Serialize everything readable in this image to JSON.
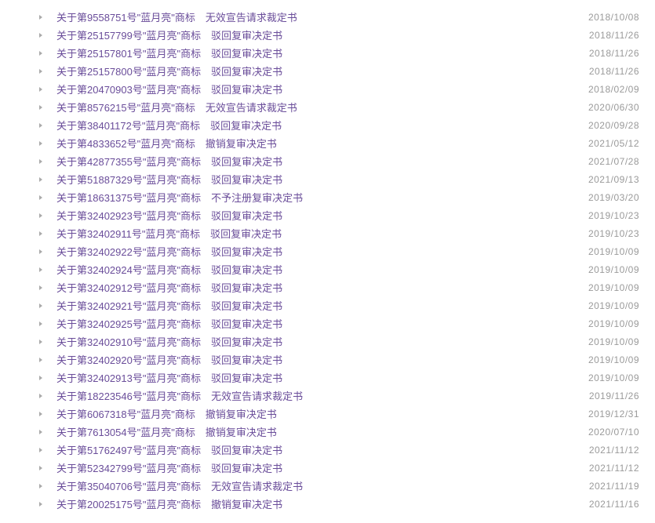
{
  "rows": [
    {
      "title": "关于第9558751号\"蓝月亮\"商标　无效宣告请求裁定书",
      "date": "2018/10/08"
    },
    {
      "title": "关于第25157799号\"蓝月亮\"商标　驳回复审决定书",
      "date": "2018/11/26"
    },
    {
      "title": "关于第25157801号\"蓝月亮\"商标　驳回复审决定书",
      "date": "2018/11/26"
    },
    {
      "title": "关于第25157800号\"蓝月亮\"商标　驳回复审决定书",
      "date": "2018/11/26"
    },
    {
      "title": "关于第20470903号\"蓝月亮\"商标　驳回复审决定书",
      "date": "2018/02/09"
    },
    {
      "title": "关于第8576215号\"蓝月亮\"商标　无效宣告请求裁定书",
      "date": "2020/06/30"
    },
    {
      "title": "关于第38401172号\"蓝月亮\"商标　驳回复审决定书",
      "date": "2020/09/28"
    },
    {
      "title": "关于第4833652号\"蓝月亮\"商标　撤销复审决定书",
      "date": "2021/05/12"
    },
    {
      "title": "关于第42877355号\"蓝月亮\"商标　驳回复审决定书",
      "date": "2021/07/28"
    },
    {
      "title": "关于第51887329号\"蓝月亮\"商标　驳回复审决定书",
      "date": "2021/09/13"
    },
    {
      "title": "关于第18631375号\"蓝月亮\"商标　不予注册复审决定书",
      "date": "2019/03/20"
    },
    {
      "title": "关于第32402923号\"蓝月亮\"商标　驳回复审决定书",
      "date": "2019/10/23"
    },
    {
      "title": "关于第32402911号\"蓝月亮\"商标　驳回复审决定书",
      "date": "2019/10/23"
    },
    {
      "title": "关于第32402922号\"蓝月亮\"商标　驳回复审决定书",
      "date": "2019/10/09"
    },
    {
      "title": "关于第32402924号\"蓝月亮\"商标　驳回复审决定书",
      "date": "2019/10/09"
    },
    {
      "title": "关于第32402912号\"蓝月亮\"商标　驳回复审决定书",
      "date": "2019/10/09"
    },
    {
      "title": "关于第32402921号\"蓝月亮\"商标　驳回复审决定书",
      "date": "2019/10/09"
    },
    {
      "title": "关于第32402925号\"蓝月亮\"商标　驳回复审决定书",
      "date": "2019/10/09"
    },
    {
      "title": "关于第32402910号\"蓝月亮\"商标　驳回复审决定书",
      "date": "2019/10/09"
    },
    {
      "title": "关于第32402920号\"蓝月亮\"商标　驳回复审决定书",
      "date": "2019/10/09"
    },
    {
      "title": "关于第32402913号\"蓝月亮\"商标　驳回复审决定书",
      "date": "2019/10/09"
    },
    {
      "title": "关于第18223546号\"蓝月亮\"商标　无效宣告请求裁定书",
      "date": "2019/11/26"
    },
    {
      "title": "关于第6067318号\"蓝月亮\"商标　撤销复审决定书",
      "date": "2019/12/31"
    },
    {
      "title": "关于第7613054号\"蓝月亮\"商标　撤销复审决定书",
      "date": "2020/07/10"
    },
    {
      "title": "关于第51762497号\"蓝月亮\"商标　驳回复审决定书",
      "date": "2021/11/12"
    },
    {
      "title": "关于第52342799号\"蓝月亮\"商标　驳回复审决定书",
      "date": "2021/11/12"
    },
    {
      "title": "关于第35040706号\"蓝月亮\"商标　无效宣告请求裁定书",
      "date": "2021/11/19"
    },
    {
      "title": "关于第20025175号\"蓝月亮\"商标　撤销复审决定书",
      "date": "2021/11/16"
    }
  ]
}
